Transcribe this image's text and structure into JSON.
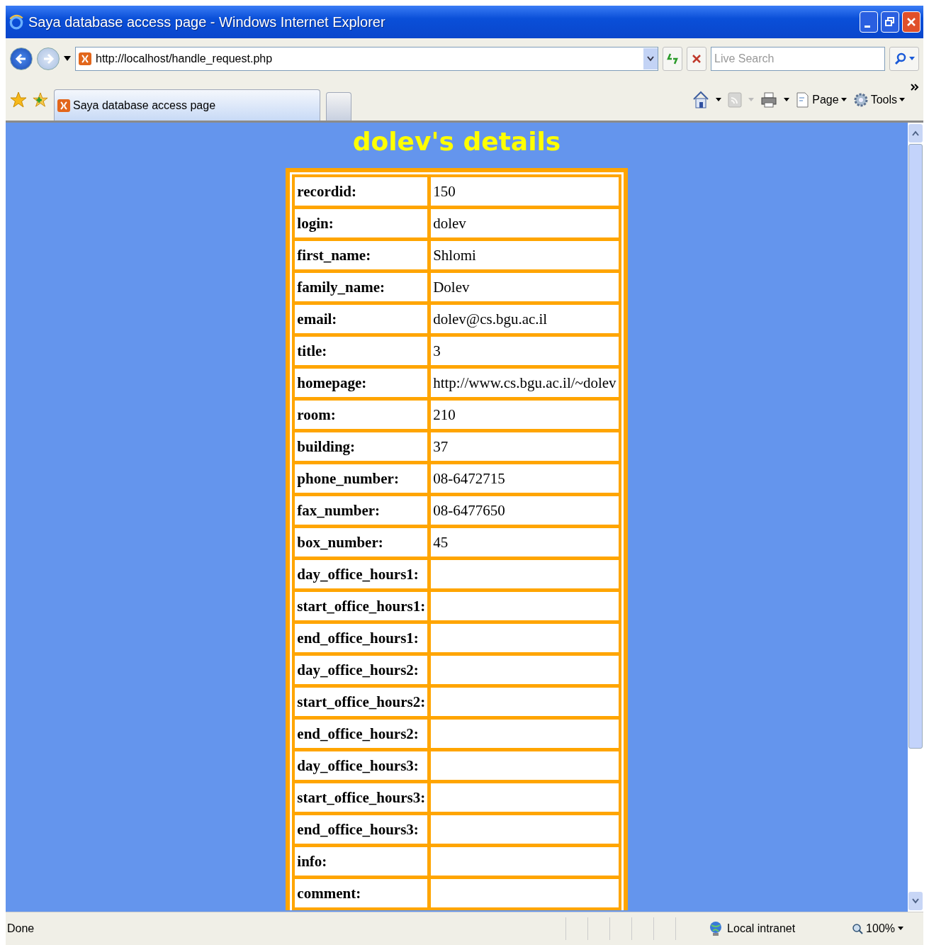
{
  "window": {
    "title": "Saya database access page - Windows Internet Explorer"
  },
  "address_bar": {
    "url": "http://localhost/handle_request.php"
  },
  "search": {
    "placeholder": "Live Search"
  },
  "tabs": [
    {
      "label": "Saya database access page",
      "selected": true
    }
  ],
  "command_bar": {
    "items": [
      "Page",
      "Tools"
    ]
  },
  "page": {
    "heading": "dolev's details",
    "fields": [
      {
        "label": "recordid:",
        "value": "150"
      },
      {
        "label": "login:",
        "value": "dolev"
      },
      {
        "label": "first_name:",
        "value": "Shlomi"
      },
      {
        "label": "family_name:",
        "value": "Dolev"
      },
      {
        "label": "email:",
        "value": "dolev@cs.bgu.ac.il"
      },
      {
        "label": "title:",
        "value": "3"
      },
      {
        "label": "homepage:",
        "value": "http://www.cs.bgu.ac.il/~dolev"
      },
      {
        "label": "room:",
        "value": "210"
      },
      {
        "label": "building:",
        "value": "37"
      },
      {
        "label": "phone_number:",
        "value": "08-6472715"
      },
      {
        "label": "fax_number:",
        "value": "08-6477650"
      },
      {
        "label": "box_number:",
        "value": "45"
      },
      {
        "label": "day_office_hours1:"
      },
      {
        "label": "start_office_hours1:"
      },
      {
        "label": "end_office_hours1:"
      },
      {
        "label": "day_office_hours2:"
      },
      {
        "label": "start_office_hours2:"
      },
      {
        "label": "end_office_hours2:"
      },
      {
        "label": "day_office_hours3:"
      },
      {
        "label": "start_office_hours3:"
      },
      {
        "label": "end_office_hours3:"
      },
      {
        "label": "info:"
      },
      {
        "label": "comment:"
      }
    ]
  },
  "status_bar": {
    "text": "Done",
    "zone": "Local intranet",
    "zoom": "100%"
  }
}
